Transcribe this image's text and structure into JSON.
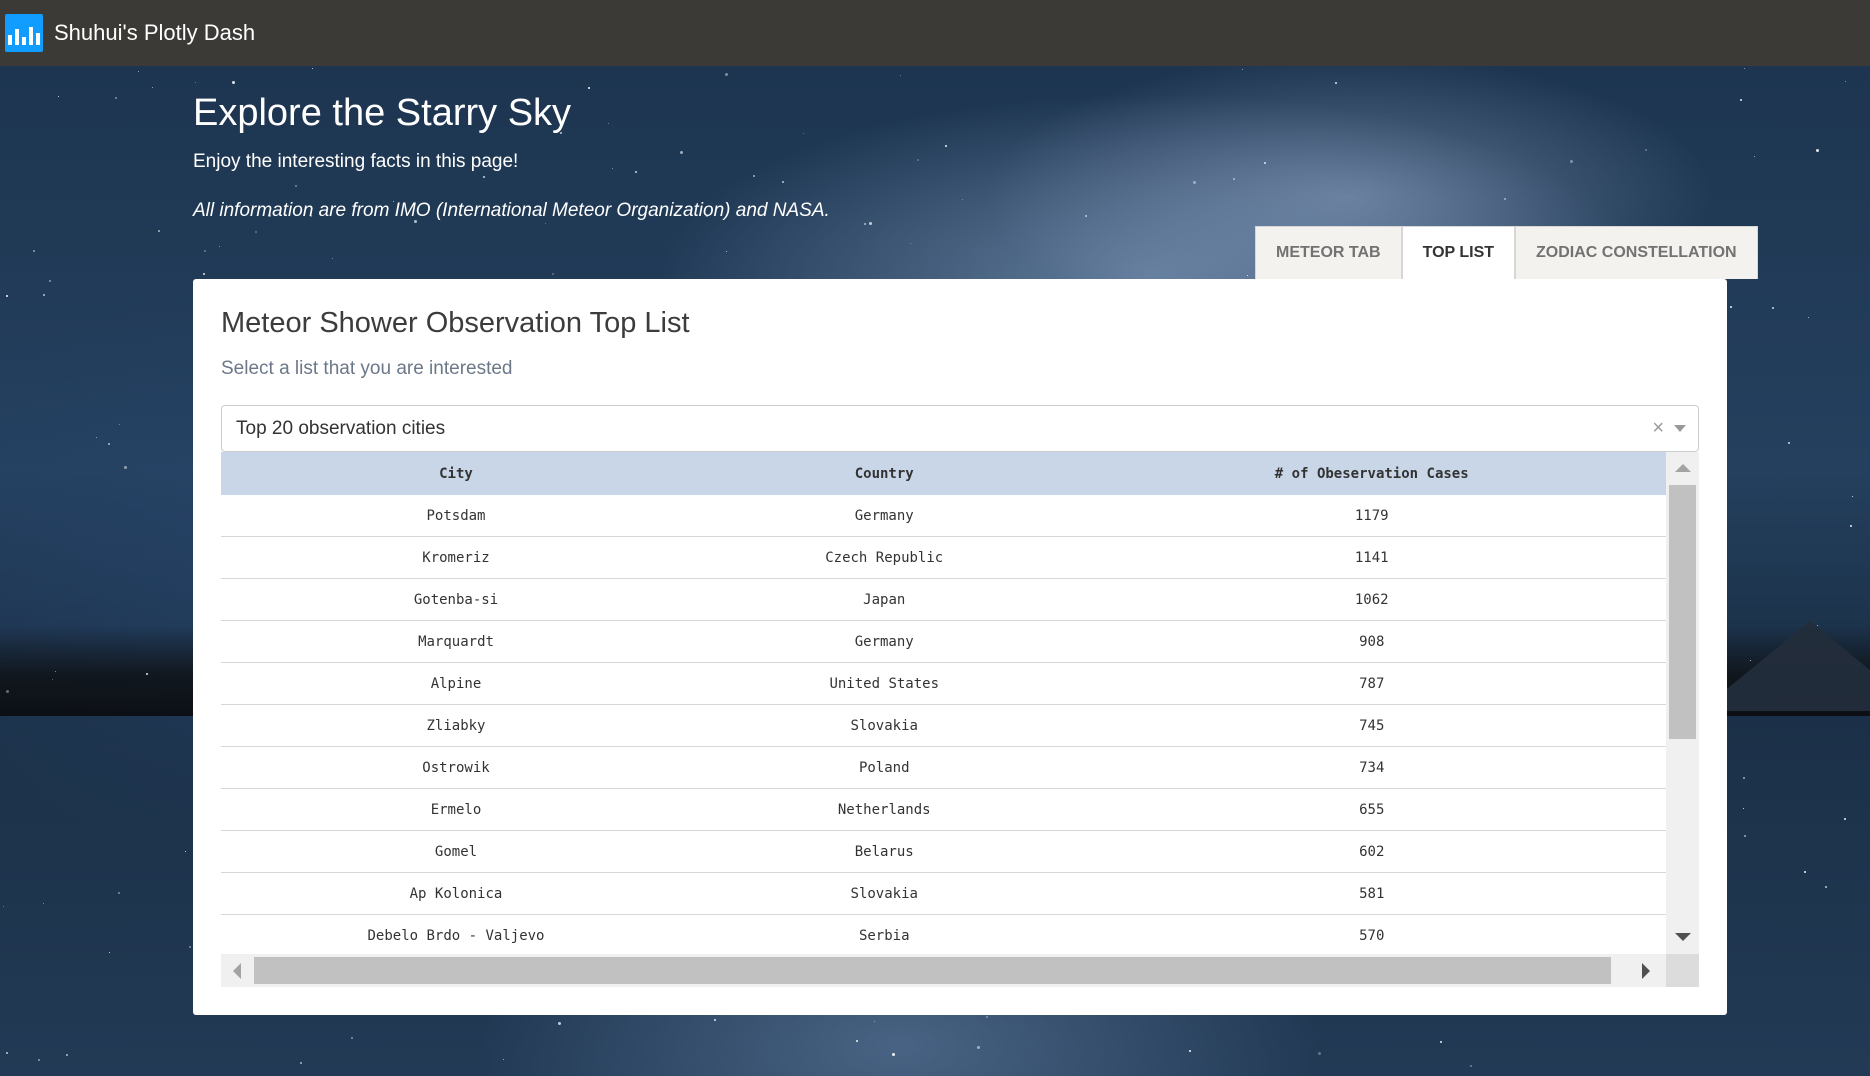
{
  "header": {
    "app_title": "Shuhui's Plotly Dash",
    "logo_icon": "plotly-bars-icon"
  },
  "hero": {
    "title": "Explore the Starry Sky",
    "subtitle": "Enjoy the interesting facts in this page!",
    "source": "All information are from IMO (International Meteor Organization) and NASA."
  },
  "tabs": [
    {
      "label": "METEOR TAB",
      "active": false
    },
    {
      "label": "TOP LIST",
      "active": true
    },
    {
      "label": "ZODIAC CONSTELLATION",
      "active": false
    }
  ],
  "card": {
    "title": "Meteor Shower Observation Top List",
    "subtitle": "Select a list that you are interested"
  },
  "dropdown": {
    "value": "Top 20 observation cities",
    "clear_icon": "×"
  },
  "table": {
    "columns": [
      "City",
      "Country",
      "# of Obeservation Cases"
    ],
    "rows": [
      [
        "Potsdam",
        "Germany",
        "1179"
      ],
      [
        "Kromeriz",
        "Czech Republic",
        "1141"
      ],
      [
        "Gotenba-si",
        "Japan",
        "1062"
      ],
      [
        "Marquardt",
        "Germany",
        "908"
      ],
      [
        "Alpine",
        "United States",
        "787"
      ],
      [
        "Zliabky",
        "Slovakia",
        "745"
      ],
      [
        "Ostrowik",
        "Poland",
        "734"
      ],
      [
        "Ermelo",
        "Netherlands",
        "655"
      ],
      [
        "Gomel",
        "Belarus",
        "602"
      ],
      [
        "Ap Kolonica",
        "Slovakia",
        "581"
      ],
      [
        "Debelo Brdo - Valjevo",
        "Serbia",
        "570"
      ]
    ]
  },
  "colors": {
    "topbar": "#3b3a36",
    "logo": "#119dff",
    "table_header": "#c9d6e8"
  }
}
